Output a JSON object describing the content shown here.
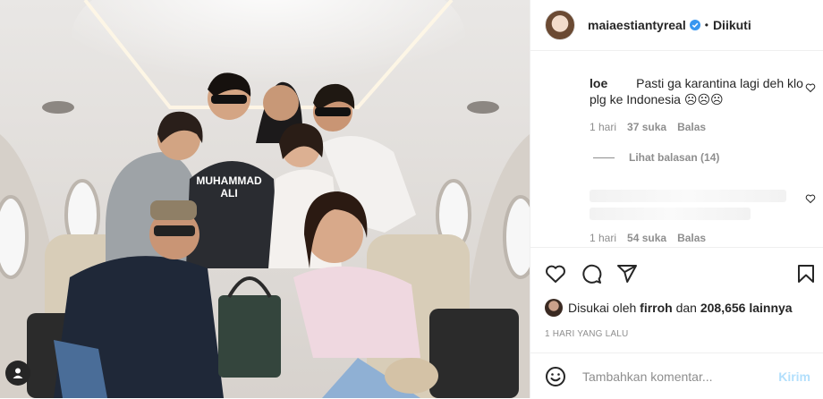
{
  "photo": {
    "alt_subject": "group-photo-in-private-jet",
    "sweater_text_line1": "MUHAMMAD",
    "sweater_text_line2": "ALI"
  },
  "header": {
    "username": "maiaestiantyreal",
    "separator": "•",
    "follow_label": "Diikuti"
  },
  "comments": [
    {
      "handle": "loe",
      "text": "Pasti ga karantina lagi deh klo plg ke Indonesia ☹☹☹",
      "time": "1 hari",
      "likes": "37 suka",
      "reply_label": "Balas",
      "view_replies": "Lihat balasan (14)"
    },
    {
      "handle": "",
      "text": "",
      "time": "1 hari",
      "likes": "54 suka",
      "reply_label": "Balas"
    }
  ],
  "likes": {
    "prefix": "Disukai oleh",
    "user": "firroh",
    "conjunction": "dan",
    "count": "208,656 lainnya"
  },
  "date": "1 HARI YANG LALU",
  "comment_box": {
    "placeholder": "Tambahkan komentar...",
    "post_label": "Kirim"
  },
  "colors": {
    "verified": "#3897f0",
    "post_button": "#b2dffc",
    "secondary_text": "#8e8e8e"
  },
  "icons": [
    "user-tag-icon",
    "verified-icon",
    "heart-icon",
    "comment-icon",
    "share-icon",
    "save-icon",
    "emoji-icon"
  ]
}
